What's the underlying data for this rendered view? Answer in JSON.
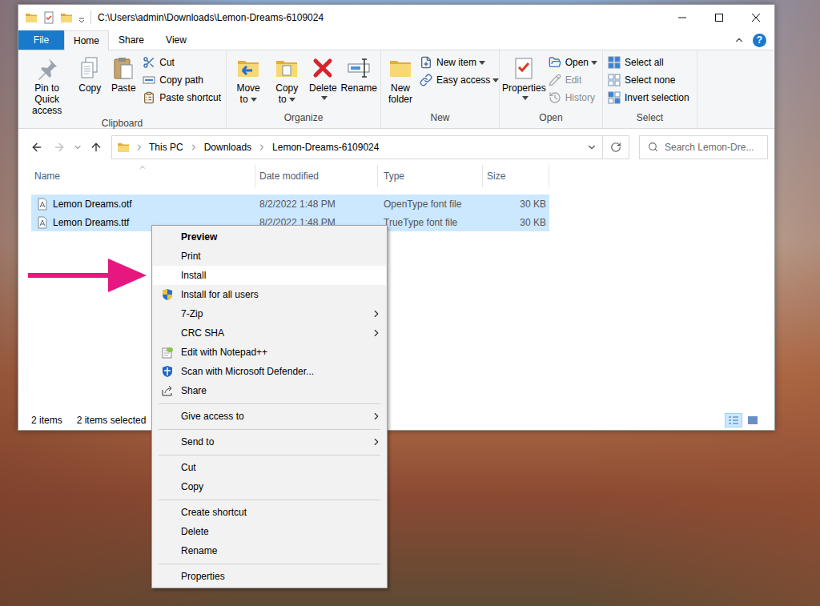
{
  "window": {
    "title": "C:\\Users\\admin\\Downloads\\Lemon-Dreams-6109024"
  },
  "ribbon_tabs": [
    {
      "label": "File",
      "selected": false
    },
    {
      "label": "Home",
      "selected": true
    },
    {
      "label": "Share",
      "selected": false
    },
    {
      "label": "View",
      "selected": false
    }
  ],
  "help": "?",
  "ribbon_groups": [
    {
      "label": "Clipboard",
      "buttons": [
        {
          "label": "Pin to Quick access",
          "kind": "large",
          "dropdown": false,
          "disabled": false
        },
        {
          "label": "Copy",
          "kind": "large",
          "dropdown": false,
          "disabled": false
        },
        {
          "label": "Paste",
          "kind": "large",
          "dropdown": false,
          "disabled": false
        },
        {
          "label": "Cut",
          "kind": "small",
          "dropdown": false,
          "disabled": false
        },
        {
          "label": "Copy path",
          "kind": "small",
          "dropdown": false,
          "disabled": false
        },
        {
          "label": "Paste shortcut",
          "kind": "small",
          "dropdown": false,
          "disabled": false
        }
      ]
    },
    {
      "label": "Organize",
      "buttons": [
        {
          "label": "Move to",
          "kind": "large",
          "dropdown": true,
          "disabled": false
        },
        {
          "label": "Copy to",
          "kind": "large",
          "dropdown": true,
          "disabled": false
        },
        {
          "label": "Delete",
          "kind": "large",
          "dropdown": true,
          "disabled": false
        },
        {
          "label": "Rename",
          "kind": "large",
          "dropdown": false,
          "disabled": false
        }
      ]
    },
    {
      "label": "New",
      "buttons": [
        {
          "label": "New folder",
          "kind": "large",
          "dropdown": false,
          "disabled": false
        },
        {
          "label": "New item",
          "kind": "small",
          "dropdown": true,
          "disabled": false
        },
        {
          "label": "Easy access",
          "kind": "small",
          "dropdown": true,
          "disabled": false
        }
      ]
    },
    {
      "label": "Open",
      "buttons": [
        {
          "label": "Properties",
          "kind": "large",
          "dropdown": true,
          "disabled": false
        },
        {
          "label": "Open",
          "kind": "small",
          "dropdown": true,
          "disabled": false
        },
        {
          "label": "Edit",
          "kind": "small",
          "dropdown": false,
          "disabled": true
        },
        {
          "label": "History",
          "kind": "small",
          "dropdown": false,
          "disabled": true
        }
      ]
    },
    {
      "label": "Select",
      "buttons": [
        {
          "label": "Select all",
          "kind": "small",
          "dropdown": false,
          "disabled": false
        },
        {
          "label": "Select none",
          "kind": "small",
          "dropdown": false,
          "disabled": false
        },
        {
          "label": "Invert selection",
          "kind": "small",
          "dropdown": false,
          "disabled": false
        }
      ]
    }
  ],
  "address": {
    "crumbs": [
      "This PC",
      "Downloads",
      "Lemon-Dreams-6109024"
    ]
  },
  "search": {
    "placeholder": "Search Lemon-Dre..."
  },
  "table": {
    "columns": [
      {
        "label": "Name",
        "sorted": true
      },
      {
        "label": "Date modified",
        "sorted": false
      },
      {
        "label": "Type",
        "sorted": false
      },
      {
        "label": "Size",
        "sorted": false
      }
    ],
    "rows": [
      {
        "name": "Lemon Dreams.otf",
        "date": "8/2/2022 1:48 PM",
        "type": "OpenType font file",
        "size": "30 KB",
        "selected": true
      },
      {
        "name": "Lemon Dreams.ttf",
        "date": "8/2/2022 1:48 PM",
        "type": "TrueType font file",
        "size": "30 KB",
        "selected": true
      }
    ]
  },
  "status_bar": {
    "count": "2 items",
    "selection": "2 items selected",
    "views": [
      {
        "selected": true
      },
      {
        "selected": false
      }
    ]
  },
  "context_menu": {
    "items": [
      {
        "kind": "item",
        "label": "Preview",
        "bold": true,
        "selected": false,
        "submenu": false
      },
      {
        "kind": "item",
        "label": "Print",
        "bold": false,
        "selected": false,
        "submenu": false
      },
      {
        "kind": "item",
        "label": "Install",
        "bold": false,
        "selected": true,
        "submenu": false
      },
      {
        "kind": "item",
        "label": "Install for all users",
        "bold": false,
        "selected": false,
        "submenu": false
      },
      {
        "kind": "item",
        "label": "7-Zip",
        "bold": false,
        "selected": false,
        "submenu": true
      },
      {
        "kind": "item",
        "label": "CRC SHA",
        "bold": false,
        "selected": false,
        "submenu": true
      },
      {
        "kind": "item",
        "label": "Edit with Notepad++",
        "bold": false,
        "selected": false,
        "submenu": false
      },
      {
        "kind": "item",
        "label": "Scan with Microsoft Defender...",
        "bold": false,
        "selected": false,
        "submenu": false
      },
      {
        "kind": "item",
        "label": "Share",
        "bold": false,
        "selected": false,
        "submenu": false
      },
      {
        "kind": "separator"
      },
      {
        "kind": "item",
        "label": "Give access to",
        "bold": false,
        "selected": false,
        "submenu": true
      },
      {
        "kind": "separator"
      },
      {
        "kind": "item",
        "label": "Send to",
        "bold": false,
        "selected": false,
        "submenu": true
      },
      {
        "kind": "separator"
      },
      {
        "kind": "item",
        "label": "Cut",
        "bold": false,
        "selected": false,
        "submenu": false
      },
      {
        "kind": "item",
        "label": "Copy",
        "bold": false,
        "selected": false,
        "submenu": false
      },
      {
        "kind": "separator"
      },
      {
        "kind": "item",
        "label": "Create shortcut",
        "bold": false,
        "selected": false,
        "submenu": false
      },
      {
        "kind": "item",
        "label": "Delete",
        "bold": false,
        "selected": false,
        "submenu": false
      },
      {
        "kind": "item",
        "label": "Rename",
        "bold": false,
        "selected": false,
        "submenu": false
      },
      {
        "kind": "separator"
      },
      {
        "kind": "item",
        "label": "Properties",
        "bold": false,
        "selected": false,
        "submenu": false
      }
    ]
  }
}
